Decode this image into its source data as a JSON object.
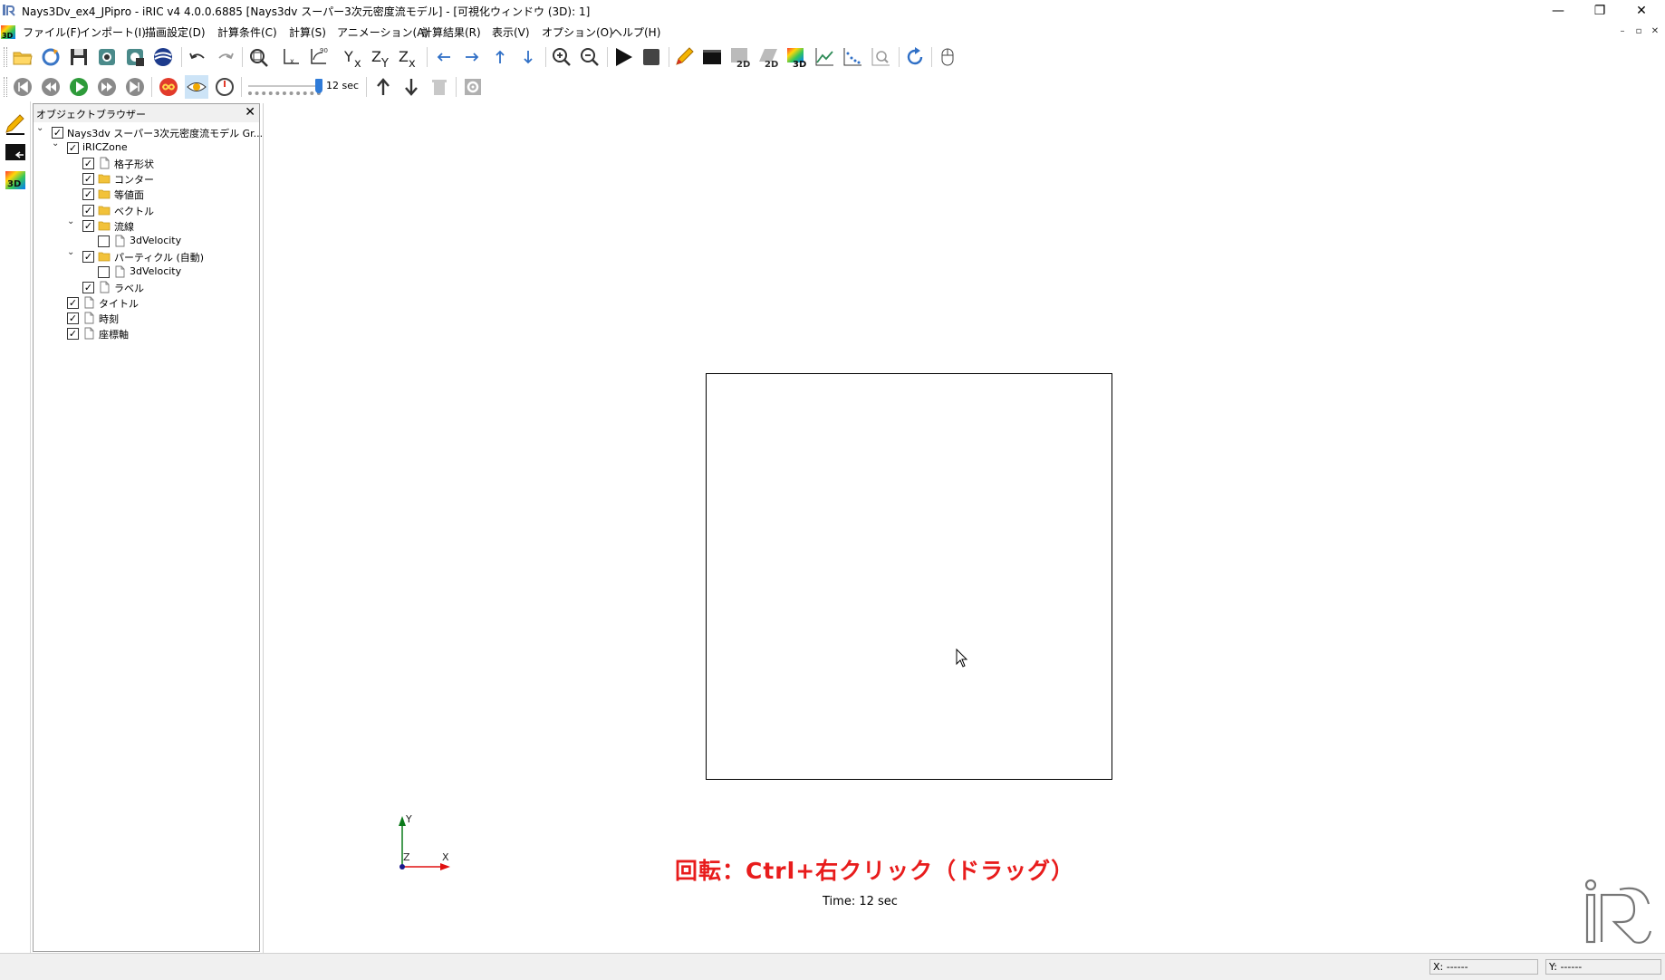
{
  "window": {
    "title": "Nays3Dv_ex4_JPipro - iRIC v4 4.0.0.6885 [Nays3dv スーパー3次元密度流モデル] - [可視化ウィンドウ (3D): 1]",
    "minimize": "—",
    "restore": "❐",
    "close": "✕"
  },
  "menu": {
    "items": [
      "ファイル(F)",
      "インポート(I)",
      "描画設定(D)",
      "計算条件(C)",
      "計算(S)",
      "アニメーション(A)",
      "計算結果(R)",
      "表示(V)",
      "オプション(O)",
      "ヘルプ(H)"
    ],
    "mdi_minimize": "–",
    "mdi_restore": "▫",
    "mdi_close": "✕"
  },
  "animation": {
    "time_value": "12 sec",
    "slider_level": 1.0
  },
  "object_browser": {
    "title": "オブジェクトブラウザー",
    "close": "✕",
    "tree": [
      {
        "label": "Nays3dv スーパー3次元密度流モデル Gr...",
        "checked": true,
        "expanded": true,
        "icon": "none"
      },
      {
        "label": "iRICZone",
        "checked": true,
        "expanded": true,
        "icon": "none"
      },
      {
        "label": "格子形状",
        "checked": true,
        "icon": "file"
      },
      {
        "label": "コンター",
        "checked": true,
        "icon": "folder"
      },
      {
        "label": "等値面",
        "checked": true,
        "icon": "folder"
      },
      {
        "label": "ベクトル",
        "checked": true,
        "icon": "folder"
      },
      {
        "label": "流線",
        "checked": true,
        "expanded": true,
        "icon": "folder"
      },
      {
        "label": "3dVelocity",
        "checked": false,
        "icon": "file"
      },
      {
        "label": "パーティクル (自動)",
        "checked": true,
        "expanded": true,
        "icon": "folder"
      },
      {
        "label": "3dVelocity",
        "checked": false,
        "icon": "file"
      },
      {
        "label": "ラベル",
        "checked": true,
        "icon": "file"
      },
      {
        "label": "タイトル",
        "checked": true,
        "icon": "file"
      },
      {
        "label": "時刻",
        "checked": true,
        "icon": "file"
      },
      {
        "label": "座標軸",
        "checked": true,
        "icon": "file"
      }
    ]
  },
  "viewport": {
    "annotation": "回転：Ctrl+右クリック（ドラッグ）",
    "time_caption": "Time:  12 sec",
    "axes": {
      "y": "Y",
      "x": "X",
      "z": "Z"
    },
    "logo": "iRIC"
  },
  "status": {
    "x": "X: ------",
    "y": "Y: ------"
  },
  "colors": {
    "annotation": "#e81c1c",
    "axis_y": "#0a7a1a",
    "axis_x": "#e01010"
  }
}
